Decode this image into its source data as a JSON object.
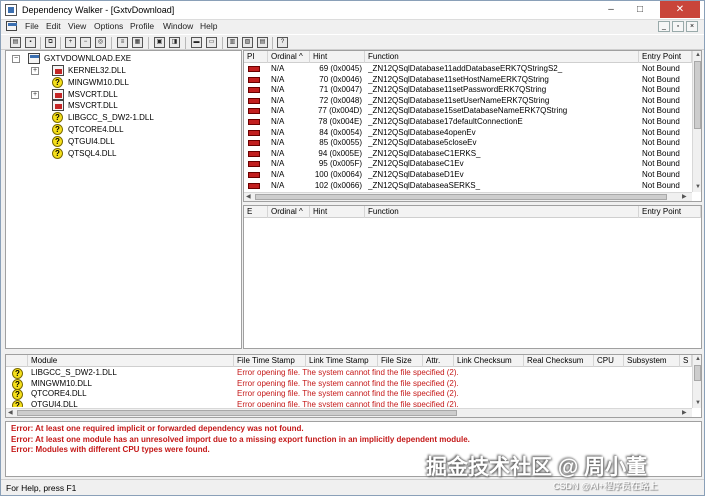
{
  "window": {
    "title": "Dependency Walker - [GxtvDownload]",
    "min_glyph": "–",
    "max_glyph": "□",
    "close_glyph": "✕",
    "mdi": [
      "_",
      "▫",
      "×"
    ]
  },
  "menu": [
    "File",
    "Edit",
    "View",
    "Options",
    "Profile",
    "Window",
    "Help"
  ],
  "toolbar": {
    "buttons": [
      "open-icon",
      "save-icon",
      "copy-icon",
      "expand-icon",
      "collapse-icon",
      "find-icon",
      "properties-icon",
      "view-icon",
      "full-paths-icon",
      "undecorate-icon",
      "function-icon",
      "system-icon",
      "tile-icon",
      "cascade-icon",
      "list-icon",
      "help-icon"
    ]
  },
  "tree": {
    "root": "GXTVDOWNLOAD.EXE",
    "items": [
      {
        "label": "KERNEL32.DLL",
        "icon": "red",
        "expand": "+"
      },
      {
        "label": "MINGWM10.DLL",
        "icon": "q",
        "expand": ""
      },
      {
        "label": "MSVCRT.DLL",
        "icon": "red",
        "expand": "+"
      },
      {
        "label": "MSVCRT.DLL",
        "icon": "red",
        "expand": ""
      },
      {
        "label": "LIBGCC_S_DW2-1.DLL",
        "icon": "q",
        "expand": ""
      },
      {
        "label": "QTCORE4.DLL",
        "icon": "q",
        "expand": ""
      },
      {
        "label": "QTGUI4.DLL",
        "icon": "q",
        "expand": ""
      },
      {
        "label": "QTSQL4.DLL",
        "icon": "q",
        "expand": ""
      }
    ]
  },
  "parent_imports": {
    "columns": [
      "PI",
      "Ordinal ^",
      "Hint",
      "Function",
      "Entry Point"
    ],
    "rows": [
      {
        "ordinal": "N/A",
        "hint": "69 (0x0045)",
        "function": "_ZN12QSqlDatabase11addDatabaseERK7QStringS2_",
        "entry": "Not Bound"
      },
      {
        "ordinal": "N/A",
        "hint": "70 (0x0046)",
        "function": "_ZN12QSqlDatabase11setHostNameERK7QString",
        "entry": "Not Bound"
      },
      {
        "ordinal": "N/A",
        "hint": "71 (0x0047)",
        "function": "_ZN12QSqlDatabase11setPasswordERK7QString",
        "entry": "Not Bound"
      },
      {
        "ordinal": "N/A",
        "hint": "72 (0x0048)",
        "function": "_ZN12QSqlDatabase11setUserNameERK7QString",
        "entry": "Not Bound"
      },
      {
        "ordinal": "N/A",
        "hint": "77 (0x004D)",
        "function": "_ZN12QSqlDatabase15setDatabaseNameERK7QString",
        "entry": "Not Bound"
      },
      {
        "ordinal": "N/A",
        "hint": "78 (0x004E)",
        "function": "_ZN12QSqlDatabase17defaultConnectionE",
        "entry": "Not Bound"
      },
      {
        "ordinal": "N/A",
        "hint": "84 (0x0054)",
        "function": "_ZN12QSqlDatabase4openEv",
        "entry": "Not Bound"
      },
      {
        "ordinal": "N/A",
        "hint": "85 (0x0055)",
        "function": "_ZN12QSqlDatabase5closeEv",
        "entry": "Not Bound"
      },
      {
        "ordinal": "N/A",
        "hint": "94 (0x005E)",
        "function": "_ZN12QSqlDatabaseC1ERKS_",
        "entry": "Not Bound"
      },
      {
        "ordinal": "N/A",
        "hint": "95 (0x005F)",
        "function": "_ZN12QSqlDatabaseC1Ev",
        "entry": "Not Bound"
      },
      {
        "ordinal": "N/A",
        "hint": "100 (0x0064)",
        "function": "_ZN12QSqlDatabaseD1Ev",
        "entry": "Not Bound"
      },
      {
        "ordinal": "N/A",
        "hint": "102 (0x0066)",
        "function": "_ZN12QSqlDatabaseaSERKS_",
        "entry": "Not Bound"
      }
    ]
  },
  "exports": {
    "columns": [
      "E",
      "Ordinal ^",
      "Hint",
      "Function",
      "Entry Point"
    ]
  },
  "modules": {
    "columns": [
      "Module",
      "File Time Stamp",
      "Link Time Stamp",
      "File Size",
      "Attr.",
      "Link Checksum",
      "Real Checksum",
      "CPU",
      "Subsystem",
      "S"
    ],
    "rows": [
      {
        "module": "LIBGCC_S_DW2-1.DLL",
        "error": "Error opening file. The system cannot find the file specified (2)."
      },
      {
        "module": "MINGWM10.DLL",
        "error": "Error opening file. The system cannot find the file specified (2)."
      },
      {
        "module": "QTCORE4.DLL",
        "error": "Error opening file. The system cannot find the file specified (2)."
      },
      {
        "module": "QTGUI4.DLL",
        "error": "Error opening file. The system cannot find the file specified (2)."
      }
    ]
  },
  "log": [
    "Error: At least one required implicit or forwarded dependency was not found.",
    "Error: At least one module has an unresolved import due to a missing export function in an implicitly dependent module.",
    "Error: Modules with different CPU types were found."
  ],
  "status": "For Help, press F1",
  "watermark": "掘金技术社区 @ 周小董",
  "watermark_small": "CSDN @AI+程序员在路上"
}
